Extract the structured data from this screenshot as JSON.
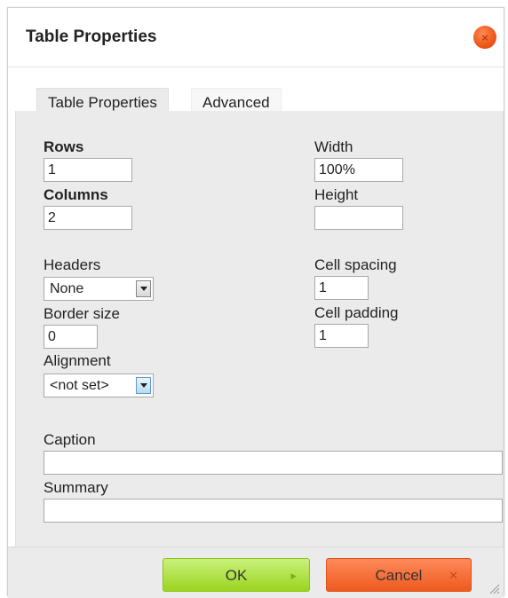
{
  "dialog": {
    "title": "Table Properties",
    "close_glyph": "×"
  },
  "tabs": [
    {
      "label": "Table Properties",
      "active": true
    },
    {
      "label": "Advanced",
      "active": false
    }
  ],
  "form": {
    "rows_label": "Rows",
    "rows_value": "1",
    "columns_label": "Columns",
    "columns_value": "2",
    "headers_label": "Headers",
    "headers_value": "None",
    "border_label": "Border size",
    "border_value": "0",
    "alignment_label": "Alignment",
    "alignment_value": "<not set>",
    "width_label": "Width",
    "width_value": "100%",
    "height_label": "Height",
    "height_value": "",
    "spacing_label": "Cell spacing",
    "spacing_value": "1",
    "padding_label": "Cell padding",
    "padding_value": "1",
    "caption_label": "Caption",
    "caption_value": "",
    "summary_label": "Summary",
    "summary_value": ""
  },
  "footer": {
    "ok_label": "OK",
    "ok_glyph": "▸",
    "cancel_label": "Cancel",
    "cancel_glyph": "✕"
  },
  "colors": {
    "close": "#ef5a1e",
    "ok": "#9bd41f",
    "cancel": "#ee5a1f",
    "panel": "#ebebeb"
  }
}
